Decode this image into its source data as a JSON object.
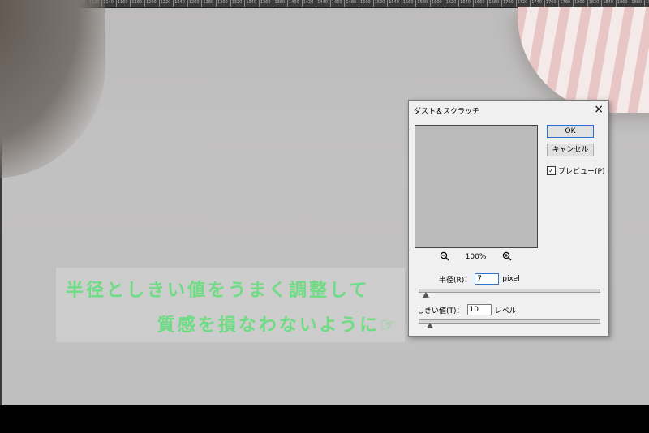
{
  "ruler": {
    "labels": [
      "1000",
      "1020",
      "1040",
      "1060",
      "1080",
      "1100",
      "1120",
      "1140",
      "1160",
      "1180",
      "1200",
      "1220",
      "1240",
      "1260",
      "1280",
      "1300",
      "1320",
      "1340",
      "1360",
      "1380",
      "1400",
      "1420",
      "1440",
      "1460",
      "1480",
      "1500",
      "1520",
      "1540",
      "1560",
      "1580",
      "1600",
      "1620",
      "1640",
      "1660",
      "1680",
      "1700",
      "1720",
      "1740",
      "1760",
      "1780",
      "1800",
      "1820",
      "1840",
      "1860",
      "1880",
      "1900",
      "1920"
    ]
  },
  "caption": {
    "line1": "半径としきい値をうまく調整して",
    "line2": "質感を損なわないように☞"
  },
  "dialog": {
    "title": "ダスト＆スクラッチ",
    "close": "×",
    "zoom": "100%",
    "ok_label": "OK",
    "cancel_label": "キャンセル",
    "preview_label": "プレビュー(P)",
    "preview_checked": true,
    "radius_label": "半径(R)：",
    "radius_value": "7",
    "radius_unit": "pixel",
    "radius_slider": 0.02,
    "threshold_label": "しきい値(T)：",
    "threshold_value": "10",
    "threshold_unit": "レベル",
    "threshold_slider": 0.04
  }
}
